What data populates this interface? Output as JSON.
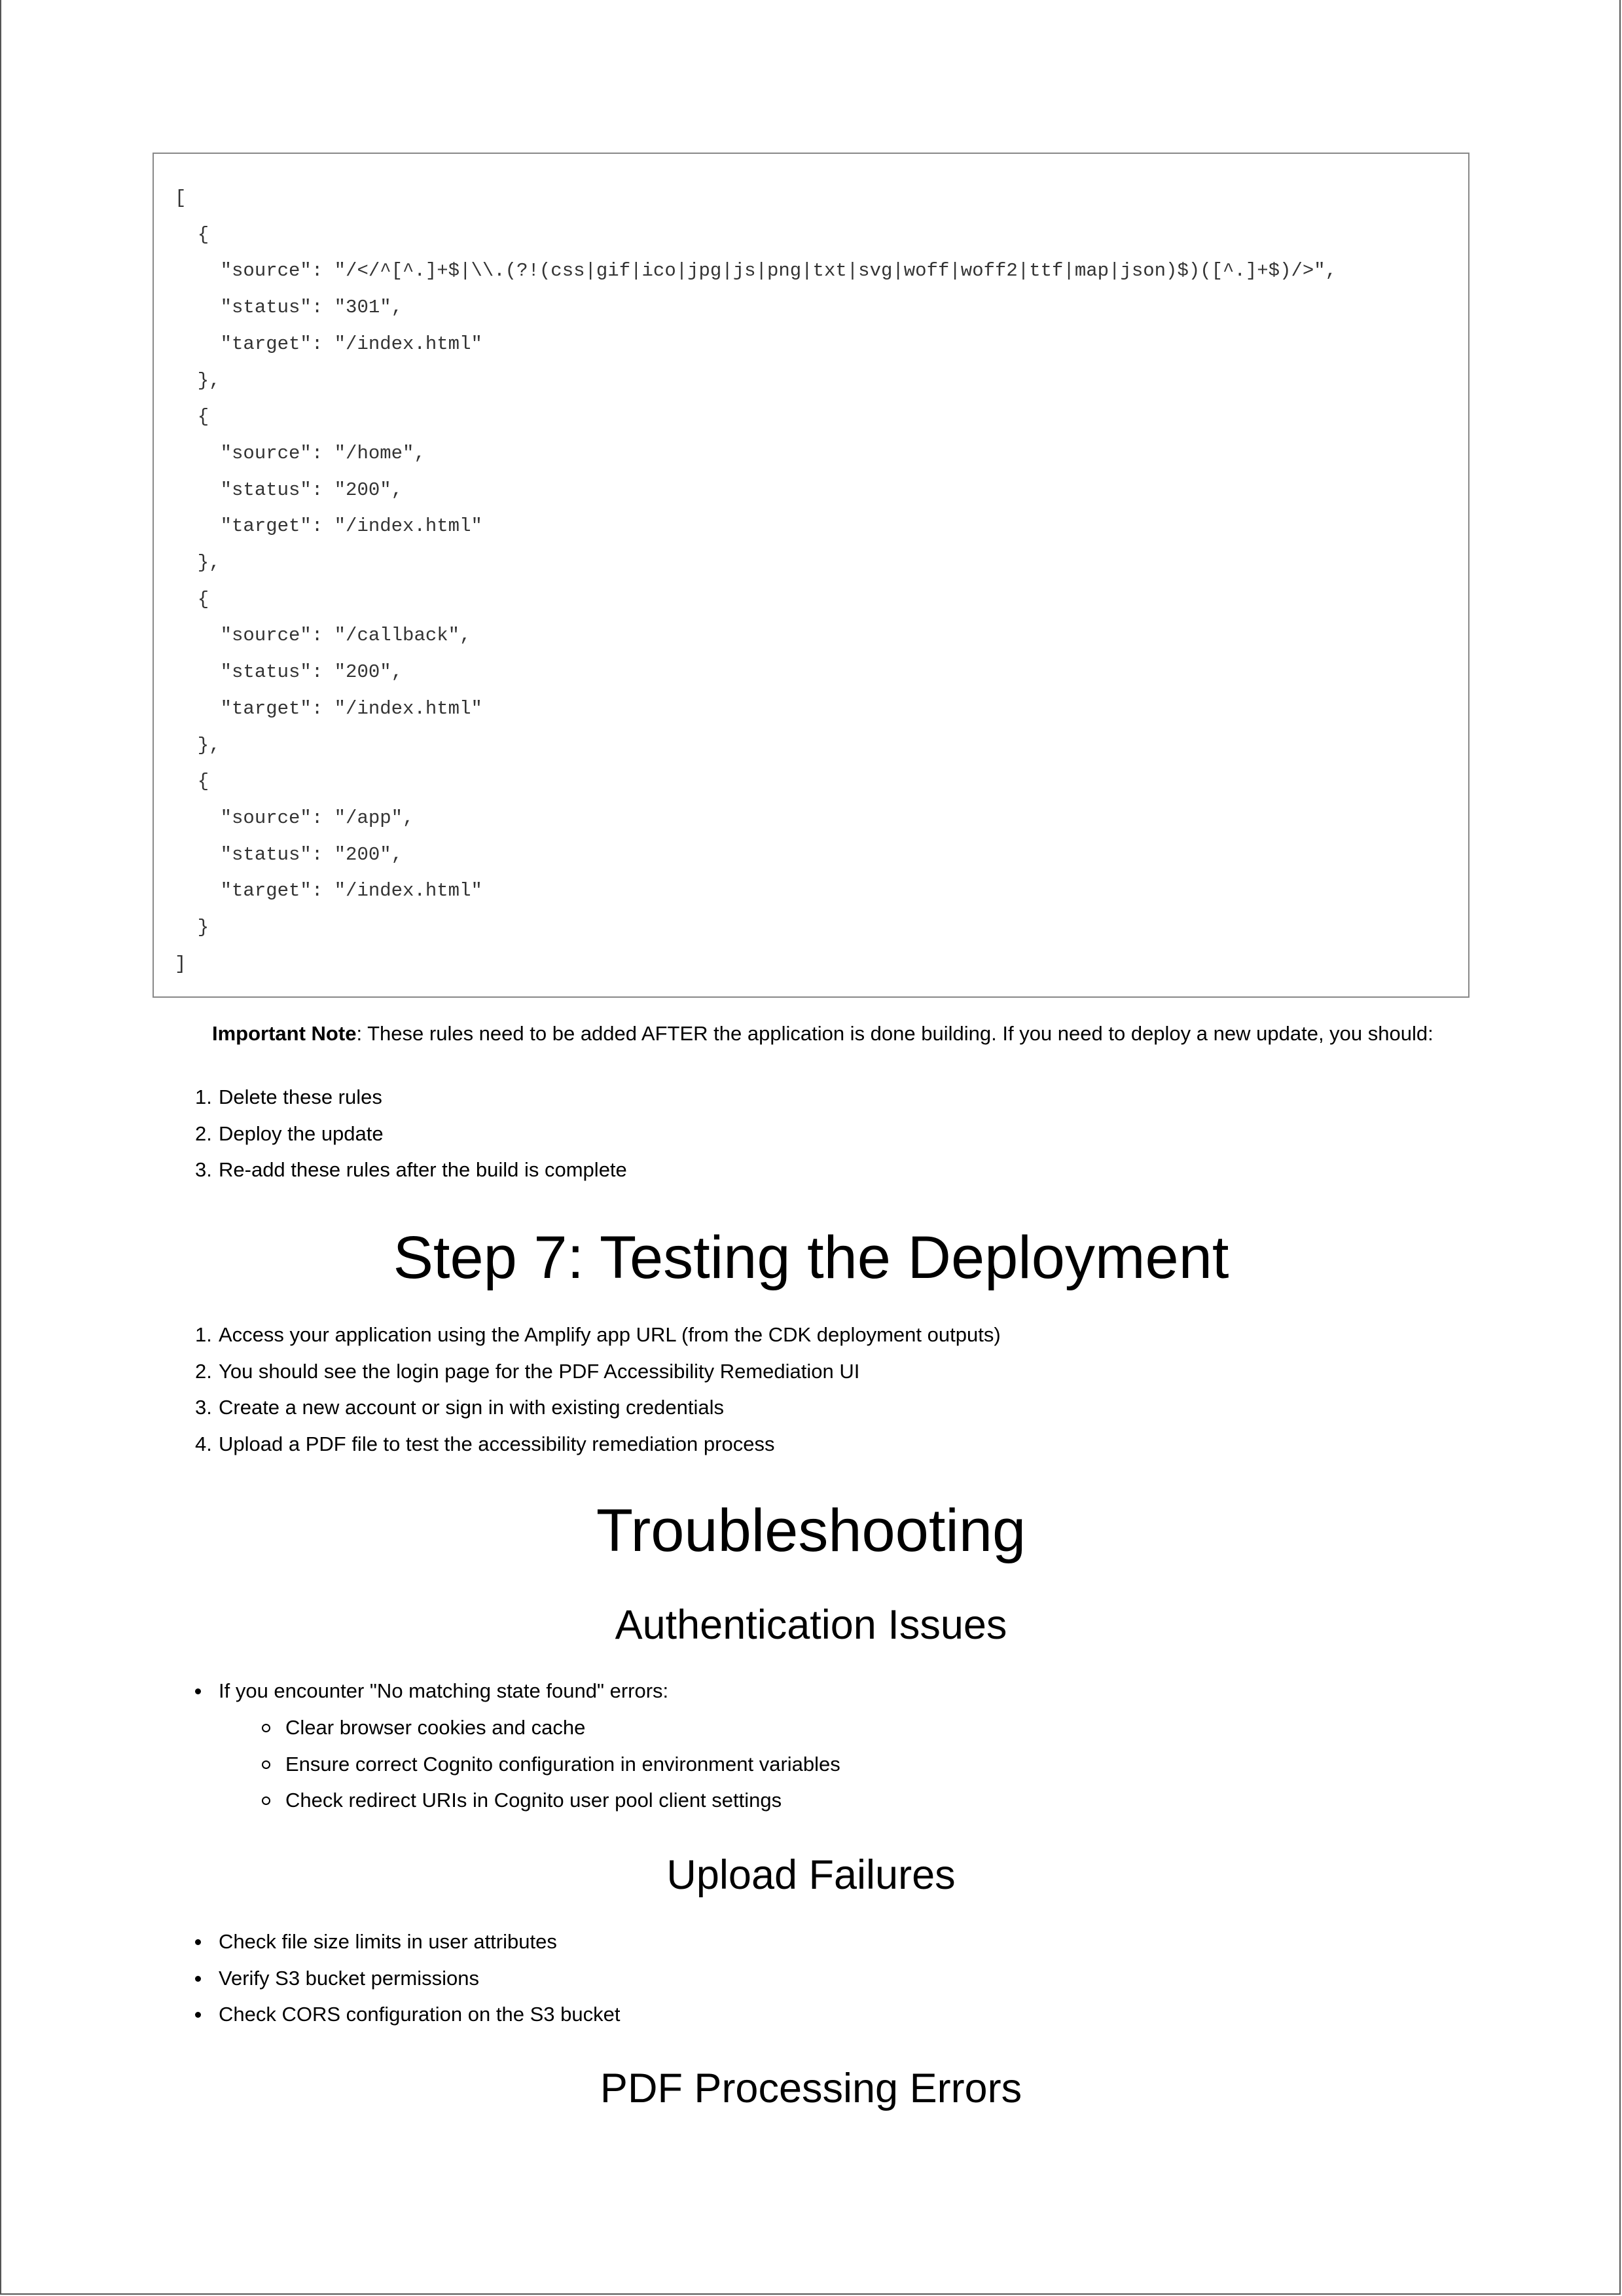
{
  "code_block": {
    "lines": [
      "[",
      "  {",
      "    \"source\": \"/</^[^.]+$|\\\\.(?!(css|gif|ico|jpg|js|png|txt|svg|woff|woff2|ttf|map|json)$)([^.]+$)/>\",",
      "    \"status\": \"301\",",
      "    \"target\": \"/index.html\"",
      "  },",
      "  {",
      "    \"source\": \"/home\",",
      "    \"status\": \"200\",",
      "    \"target\": \"/index.html\"",
      "  },",
      "  {",
      "    \"source\": \"/callback\",",
      "    \"status\": \"200\",",
      "    \"target\": \"/index.html\"",
      "  },",
      "  {",
      "    \"source\": \"/app\",",
      "    \"status\": \"200\",",
      "    \"target\": \"/index.html\"",
      "  }",
      "]"
    ]
  },
  "important_note": {
    "label": "Important Note",
    "text": ": These rules need to be added AFTER the application is done building. If you need to deploy a new update, you should:"
  },
  "rules_steps": [
    {
      "num": "1.",
      "text": "Delete these rules"
    },
    {
      "num": "2.",
      "text": "Deploy the update"
    },
    {
      "num": "3.",
      "text": "Re-add these rules after the build is complete"
    }
  ],
  "step7": {
    "heading": "Step 7: Testing the Deployment",
    "items": [
      {
        "num": "1.",
        "text": "Access your application using the Amplify app URL (from the CDK deployment outputs)"
      },
      {
        "num": "2.",
        "text": "You should see the login page for the PDF Accessibility Remediation UI"
      },
      {
        "num": "3.",
        "text": "Create a new account or sign in with existing credentials"
      },
      {
        "num": "4.",
        "text": "Upload a PDF file to test the accessibility remediation process"
      }
    ]
  },
  "troubleshooting": {
    "heading": "Troubleshooting",
    "auth": {
      "heading": "Authentication Issues",
      "item": "If you encounter \"No matching state found\" errors:",
      "subitems": [
        "Clear browser cookies and cache",
        "Ensure correct Cognito configuration in environment variables",
        "Check redirect URIs in Cognito user pool client settings"
      ]
    },
    "upload": {
      "heading": "Upload Failures",
      "items": [
        "Check file size limits in user attributes",
        "Verify S3 bucket permissions",
        "Check CORS configuration on the S3 bucket"
      ]
    },
    "pdf": {
      "heading": "PDF Processing Errors"
    }
  }
}
